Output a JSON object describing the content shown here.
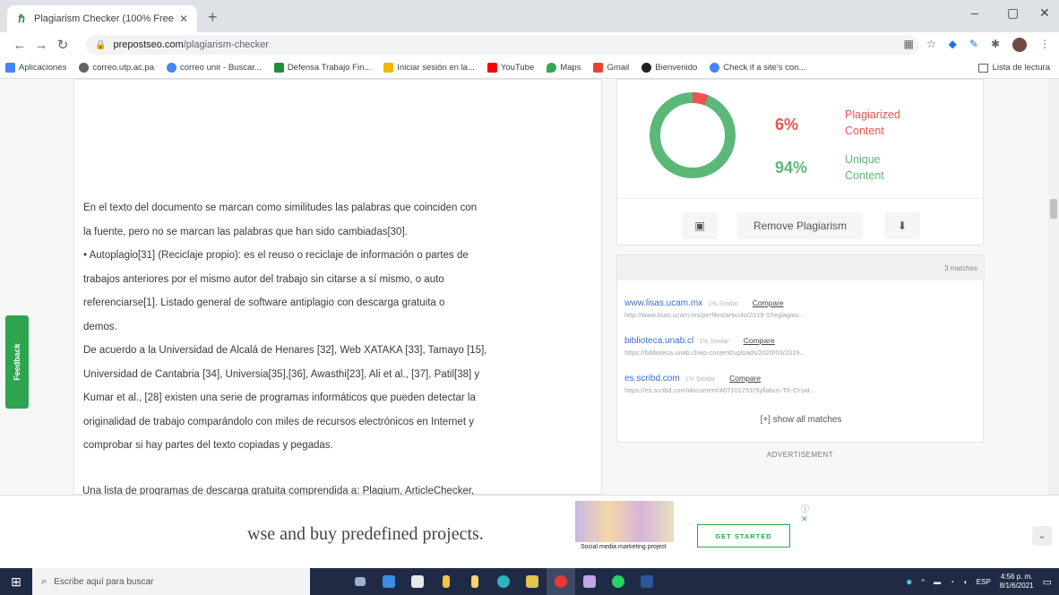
{
  "browser": {
    "tab_title": "Plagiarism Checker (100% Free Pl",
    "tab_close": "✕",
    "new_tab": "+",
    "window_min": "–",
    "window_max": "▢",
    "window_close": "✕",
    "url_domain": "prepostseo.com",
    "url_path": "/plagiarism-checker"
  },
  "bookmarks": [
    {
      "label": "Aplicaciones",
      "color": "#4285f4"
    },
    {
      "label": "correo.utp.ac.pa",
      "color": "#5f6368"
    },
    {
      "label": "correo unir - Buscar...",
      "color": "#4285f4"
    },
    {
      "label": "Defensa Trabajo Fin...",
      "color": "#1e8e3e"
    },
    {
      "label": "Iniciar sesión en la...",
      "color": "#f4b400"
    },
    {
      "label": "YouTube",
      "color": "#ff0000"
    },
    {
      "label": "Maps",
      "color": "#34a853"
    },
    {
      "label": "Gmail",
      "color": "#ea4335"
    },
    {
      "label": "Bienvenido",
      "color": "#202124"
    },
    {
      "label": "Check if a site's con...",
      "color": "#4285f4"
    }
  ],
  "reading_list": "Lista de lectura",
  "document": {
    "lines": [
      "En el texto del documento se marcan como similitudes las palabras que coinciden con",
      "la fuente, pero no se marcan las palabras que han sido cambiadas[30].",
      "• Autoplagio[31] (Reciclaje propio): es el reuso o reciclaje de información o partes de",
      "trabajos anteriores por el mismo autor del trabajo sin citarse a sí mismo, o auto",
      "referenciarse[1].  Listado general de software antiplagio con descarga gratuita o",
      "demos.",
      "De acuerdo a la Universidad de Alcalá de Henares [32], Web XATAKA [33], Tamayo [15],",
      "Universidad de Cantabria [34], Universia[35],[36], Awasthi[23], Ali et al., [37], Patil[38] y",
      "Kumar et al., [28] existen una serie de programas informáticos que pueden detectar la",
      "originalidad de trabajo comparándolo con miles de recursos electrónicos en Internet y",
      "comprobar si hay partes del texto copiadas y pegadas."
    ],
    "partial_line": "Una lista de programas de descarga gratuita comprendida a: Plagium, ArticleChecker,"
  },
  "results": {
    "plagiarized_percent": "6%",
    "plagiarized_label_1": "Plagiarized",
    "plagiarized_label_2": "Content",
    "unique_percent": "94%",
    "unique_label_1": "Unique",
    "unique_label_2": "Content",
    "plagiarized_fraction": 0.06,
    "colors": {
      "plagiarized": "#ef5350",
      "unique": "#5cb878"
    },
    "remove_button": "Remove Plagiarism"
  },
  "matches": {
    "header": "3 matches",
    "items": [
      {
        "domain": "www.lisas.ucam.mx",
        "similarity": "1% Similar",
        "compare": "Compare",
        "source": "http://www.lisas.ucam.mx/perfiles/articulo/2019-1/reglagios..."
      },
      {
        "domain": "biblioteca.unab.cl",
        "similarity": "1% Similar",
        "compare": "Compare",
        "source": "https://biblioteca.unab.cl/wp-content/uploads/2020/03/2019..."
      },
      {
        "domain": "es.scribd.com",
        "similarity": "1% Similar",
        "compare": "Compare",
        "source": "https://es.scribd.com/document/467101751/Syllabus-Tfr-Ct-pd..."
      }
    ],
    "show_all": "[+] show all matches"
  },
  "advertisement_label": "ADVERTISEMENT",
  "feedback_label": "Feedback",
  "ad": {
    "headline": "wse and buy predefined projects.",
    "image_caption": "Social media marketing project",
    "cta": "GET STARTED",
    "close": "ⓘ ✕"
  },
  "taskbar": {
    "search_placeholder": "Escribe aquí para buscar",
    "lang": "ESP",
    "time": "4:56 p. m.",
    "date": "8/1/6/2021"
  }
}
